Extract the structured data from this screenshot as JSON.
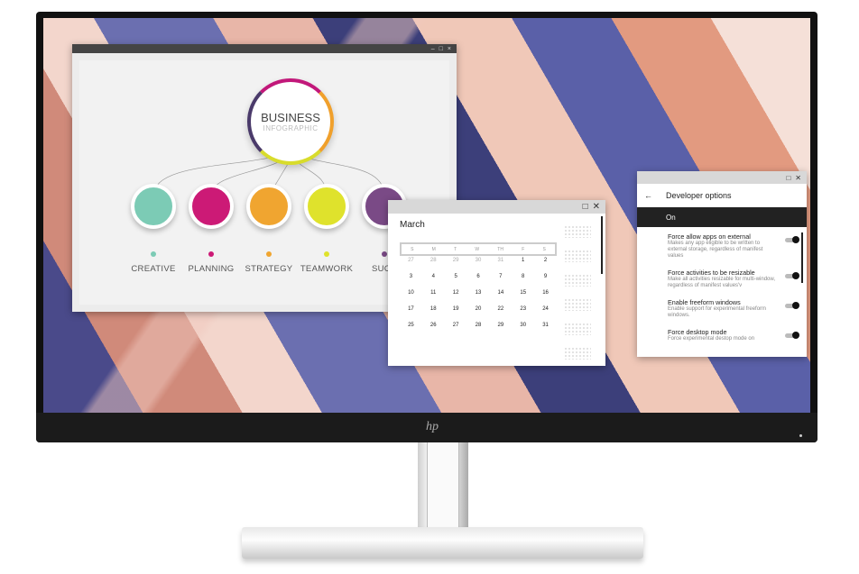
{
  "brand": "hp",
  "infographic": {
    "title": "BUSINESS",
    "subtitle": "INFOGRAPHIC",
    "window_controls": [
      "–",
      "□",
      "×"
    ],
    "nodes": [
      {
        "label": "CREATIVE",
        "color": "#7ccbb5"
      },
      {
        "label": "PLANNING",
        "color": "#cc1a76"
      },
      {
        "label": "STRATEGY",
        "color": "#f0a530"
      },
      {
        "label": "TEAMWORK",
        "color": "#dfe22c"
      },
      {
        "label": "SUCC",
        "color": "#7a4a86"
      }
    ]
  },
  "calendar": {
    "month": "March",
    "weekdays": [
      "S",
      "M",
      "T",
      "W",
      "TH",
      "F",
      "S"
    ],
    "days": [
      "27",
      "28",
      "29",
      "30",
      "31",
      "1",
      "2",
      "3",
      "4",
      "5",
      "6",
      "7",
      "8",
      "9",
      "10",
      "11",
      "12",
      "13",
      "14",
      "15",
      "16",
      "17",
      "18",
      "19",
      "20",
      "22",
      "23",
      "24",
      "25",
      "26",
      "27",
      "28",
      "29",
      "30",
      "31"
    ],
    "muted_count": 5,
    "controls": [
      "□",
      "✕"
    ]
  },
  "developer": {
    "title": "Developer options",
    "back": "←",
    "status": "On",
    "controls": [
      "□",
      "✕"
    ],
    "options": [
      {
        "title": "Force allow apps on external",
        "desc": "Makes any app eligible to be written to external storage, regardless of manifest values",
        "enabled": true
      },
      {
        "title": "Force activities to be resizable",
        "desc": "Make all activities resizable for multi-window, regardless of manifest values'v",
        "enabled": true
      },
      {
        "title": "Enable freeform windows",
        "desc": "Enable support for experimental freeform windows.",
        "enabled": true
      },
      {
        "title": "Force desktop mode",
        "desc": "Force experimental destop mode on",
        "enabled": true
      }
    ]
  }
}
